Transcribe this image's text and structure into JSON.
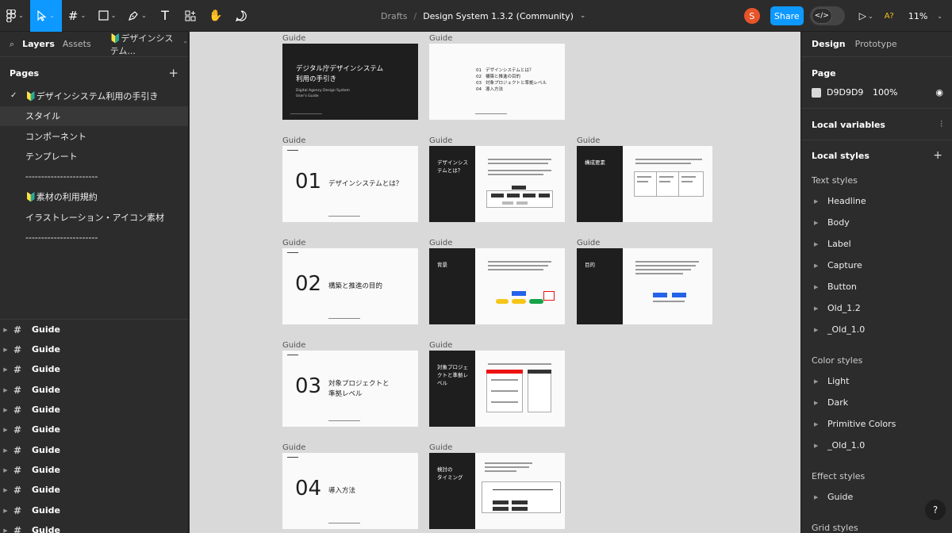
{
  "toolbar": {
    "breadcrumb": "Drafts",
    "separator": "/",
    "filename": "Design System 1.3.2 (Community)",
    "avatar_initial": "S",
    "share_label": "Share",
    "accessibility_label": "A?",
    "zoom": "11%",
    "colors": {
      "accent": "#0d99ff",
      "avatar": "#e8542a"
    }
  },
  "left_panel": {
    "tabs": [
      "Layers",
      "Assets"
    ],
    "page_dropdown": "🔰デザインシステム...",
    "pages_heading": "Pages",
    "pages": [
      {
        "label": "🔰デザインシステム利用の手引き",
        "checked": true
      },
      {
        "label": "スタイル",
        "selected": true
      },
      {
        "label": "コンポーネント"
      },
      {
        "label": "テンプレート"
      },
      {
        "label": "-----------------------"
      },
      {
        "label": "🔰素材の利用規約"
      },
      {
        "label": "イラストレーション・アイコン素材"
      },
      {
        "label": "-----------------------"
      }
    ],
    "layers": [
      "Guide",
      "Guide",
      "Guide",
      "Guide",
      "Guide",
      "Guide",
      "Guide",
      "Guide",
      "Guide",
      "Guide",
      "Guide"
    ]
  },
  "canvas": {
    "background": "#d9d9d9",
    "frame_label": "Guide",
    "cover": {
      "title_line1": "デジタル庁デザインシステム",
      "title_line2": "利用の手引き",
      "sub_line1": "Digital Agency Design System",
      "sub_line2": "User's Guide"
    },
    "toc": [
      {
        "num": "01",
        "text": "デザインシステムとは？"
      },
      {
        "num": "02",
        "text": "構築と推進の目的"
      },
      {
        "num": "03",
        "text": "対象プロジェクトと準拠レベル"
      },
      {
        "num": "04",
        "text": "導入方法"
      }
    ],
    "sections": [
      {
        "num": "01",
        "title_line1": "デザインシステムとは？",
        "title_line2": ""
      },
      {
        "num": "02",
        "title_line1": "構築と推進の目的",
        "title_line2": ""
      },
      {
        "num": "03",
        "title_line1": "対象プロジェクトと",
        "title_line2": "準拠レベル"
      },
      {
        "num": "04",
        "title_line1": "導入方法",
        "title_line2": ""
      }
    ],
    "split_titles": [
      {
        "line1": "デザインシス",
        "line2": "テムとは？",
        "line3": ""
      },
      {
        "line1": "構成要素",
        "line2": "",
        "line3": ""
      },
      {
        "line1": "背景",
        "line2": "",
        "line3": ""
      },
      {
        "line1": "目的",
        "line2": "",
        "line3": ""
      },
      {
        "line1": "対象プロジェ",
        "line2": "クトと準拠レ",
        "line3": "ベル"
      },
      {
        "line1": "検討の",
        "line2": "タイミング",
        "line3": ""
      }
    ]
  },
  "right_panel": {
    "tabs": [
      "Design",
      "Prototype"
    ],
    "page_heading": "Page",
    "page_color": "D9D9D9",
    "page_opacity": "100%",
    "local_variables": "Local variables",
    "local_styles": "Local styles",
    "text_styles_heading": "Text styles",
    "text_styles": [
      "Headline",
      "Body",
      "Label",
      "Capture",
      "Button",
      "Old_1.2",
      "_Old_1.0"
    ],
    "color_styles_heading": "Color styles",
    "color_styles": [
      "Light",
      "Dark",
      "Primitive Colors",
      "_Old_1.0"
    ],
    "effect_styles_heading": "Effect styles",
    "effect_styles": [
      "Guide"
    ],
    "grid_styles_heading": "Grid styles",
    "help": "?"
  }
}
